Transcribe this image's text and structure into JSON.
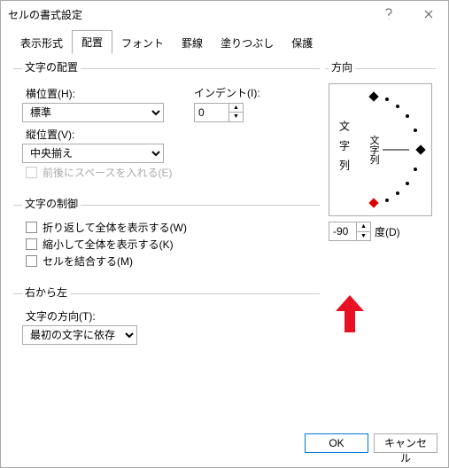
{
  "window": {
    "title": "セルの書式設定"
  },
  "tabs": [
    "表示形式",
    "配置",
    "フォント",
    "罫線",
    "塗りつぶし",
    "保護"
  ],
  "active_tab": 1,
  "alignment": {
    "group": "文字の配置",
    "h_label": "横位置(H):",
    "h_value": "標準",
    "indent_label": "インデント(I):",
    "indent_value": "0",
    "v_label": "縦位置(V):",
    "v_value": "中央揃え",
    "justify": "前後にスペースを入れる(E)"
  },
  "control": {
    "group": "文字の制御",
    "wrap": "折り返して全体を表示する(W)",
    "shrink": "縮小して全体を表示する(K)",
    "merge": "セルを結合する(M)"
  },
  "rtl": {
    "group": "右から左",
    "dir_label": "文字の方向(T):",
    "dir_value": "最初の文字に依存"
  },
  "orientation": {
    "group": "方向",
    "vtext": "文字列",
    "arc_label": "文字列",
    "deg_value": "-90",
    "deg_label": "度(D)"
  },
  "footer": {
    "ok": "OK",
    "cancel": "キャンセル"
  }
}
